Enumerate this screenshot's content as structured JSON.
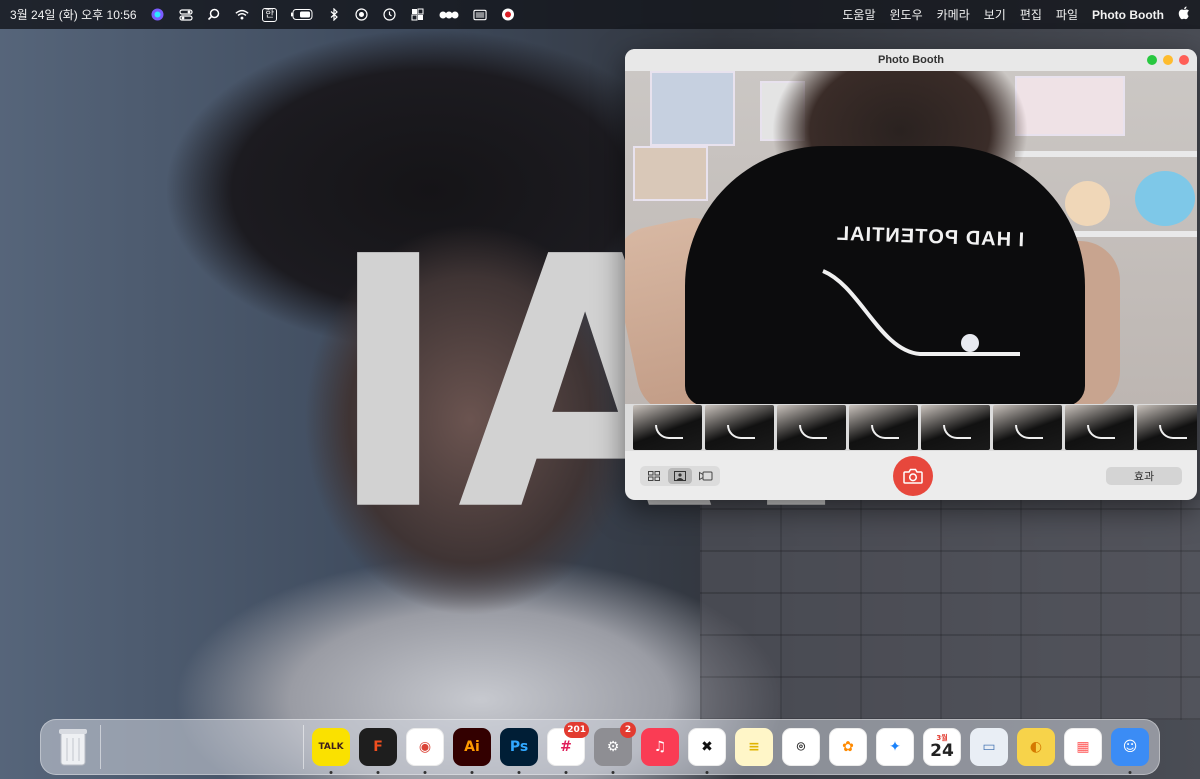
{
  "menubar": {
    "apple_icon": "apple-icon",
    "app_name": "Photo Booth",
    "menus": [
      "파일",
      "편집",
      "보기",
      "카메라",
      "윈도우",
      "도움말"
    ],
    "clock": "3월 24일 (화) 오후 10:56",
    "status_icons": [
      "siri-icon",
      "control-center-icon",
      "spotlight-icon",
      "wifi-icon",
      "input-method-icon",
      "battery-icon",
      "bluetooth-icon",
      "screen-record-icon",
      "time-machine-icon",
      "extension-icon",
      "dots-icon",
      "display-icon",
      "creative-cloud-icon"
    ],
    "input_method_label": "한"
  },
  "wallpaper": {
    "overlay_text": "!AI"
  },
  "window": {
    "title": "Photo Booth",
    "shirt_text": "I HAD POTENTIAL",
    "effects_label": "효과",
    "filmstrip_count": 8,
    "view_modes": [
      "grid-view",
      "single-view",
      "video-view"
    ]
  },
  "dock": {
    "apps": [
      {
        "name": "kakaotalk",
        "label": "TALK",
        "bg": "#fae100",
        "fg": "#3c1e1e",
        "running": true
      },
      {
        "name": "figma",
        "label": "F",
        "bg": "#1e1e1e",
        "fg": "#f24e1e",
        "running": true
      },
      {
        "name": "chrome",
        "label": "◉",
        "bg": "#ffffff",
        "fg": "#db4437",
        "running": true
      },
      {
        "name": "illustrator",
        "label": "Ai",
        "bg": "#330000",
        "fg": "#ff9a00",
        "running": true
      },
      {
        "name": "photoshop",
        "label": "Ps",
        "bg": "#001e36",
        "fg": "#31a8ff",
        "running": true
      },
      {
        "name": "slack",
        "label": "#",
        "bg": "#ffffff",
        "fg": "#e01e5a",
        "running": true,
        "badge": "201"
      },
      {
        "name": "system-preferences",
        "label": "⚙",
        "bg": "#8e8e93",
        "fg": "#ffffff",
        "running": true,
        "badge": "2"
      },
      {
        "name": "music",
        "label": "♫",
        "bg": "#fa3c54",
        "fg": "#ffffff",
        "running": false
      },
      {
        "name": "capcut",
        "label": "✖",
        "bg": "#ffffff",
        "fg": "#111111",
        "running": true
      },
      {
        "name": "notes",
        "label": "≡",
        "bg": "#fff6c8",
        "fg": "#e0b400",
        "running": false
      },
      {
        "name": "screenshot",
        "label": "⌾",
        "bg": "#ffffff",
        "fg": "#333333",
        "running": false
      },
      {
        "name": "photos",
        "label": "✿",
        "bg": "#ffffff",
        "fg": "#ff8a00",
        "running": false
      },
      {
        "name": "safari",
        "label": "✦",
        "bg": "#ffffff",
        "fg": "#1a82fb",
        "running": false
      },
      {
        "name": "calendar",
        "label": "24",
        "bg": "#ffffff",
        "fg": "#222222",
        "running": false,
        "month": "3월"
      },
      {
        "name": "preview",
        "label": "▭",
        "bg": "#e9eef5",
        "fg": "#4a78b5",
        "running": false
      },
      {
        "name": "cyberduck",
        "label": "◐",
        "bg": "#f7d34a",
        "fg": "#d57a00",
        "running": false
      },
      {
        "name": "launchpad",
        "label": "▦",
        "bg": "#ffffff",
        "fg": "#ff5a5a",
        "running": false
      },
      {
        "name": "finder",
        "label": "☺",
        "bg": "#3b8cf5",
        "fg": "#ffffff",
        "running": true
      }
    ],
    "trash": "trash-icon"
  },
  "colors": {
    "close": "#ff5f57",
    "minimize": "#febc2e",
    "zoom": "#28c840",
    "shutter": "#e7473c"
  }
}
